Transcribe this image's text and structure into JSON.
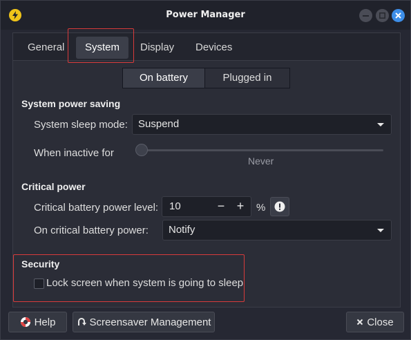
{
  "window": {
    "title": "Power Manager"
  },
  "tabs": [
    {
      "label": "General"
    },
    {
      "label": "System"
    },
    {
      "label": "Display"
    },
    {
      "label": "Devices"
    }
  ],
  "power_mode": {
    "options": [
      "On battery",
      "Plugged in"
    ],
    "selected": "On battery"
  },
  "system_power_saving": {
    "heading": "System power saving",
    "sleep_mode_label": "System sleep mode:",
    "sleep_mode_value": "Suspend",
    "inactive_label": "When inactive for",
    "inactive_value": "Never",
    "inactive_slider_fraction": 0
  },
  "critical_power": {
    "heading": "Critical power",
    "level_label": "Critical battery power level:",
    "level_value": "10",
    "minus": "−",
    "plus": "+",
    "unit": "%",
    "action_label": "On critical battery power:",
    "action_value": "Notify"
  },
  "security": {
    "heading": "Security",
    "lock_label": "Lock screen when system is going to sleep",
    "lock_checked": false
  },
  "footer": {
    "help_label": "Help",
    "screensaver_label": "Screensaver Management",
    "close_label": "Close"
  },
  "colors": {
    "accent": "#3d8ee8",
    "highlight": "#d93b3b",
    "app_icon": "#f0c419"
  }
}
